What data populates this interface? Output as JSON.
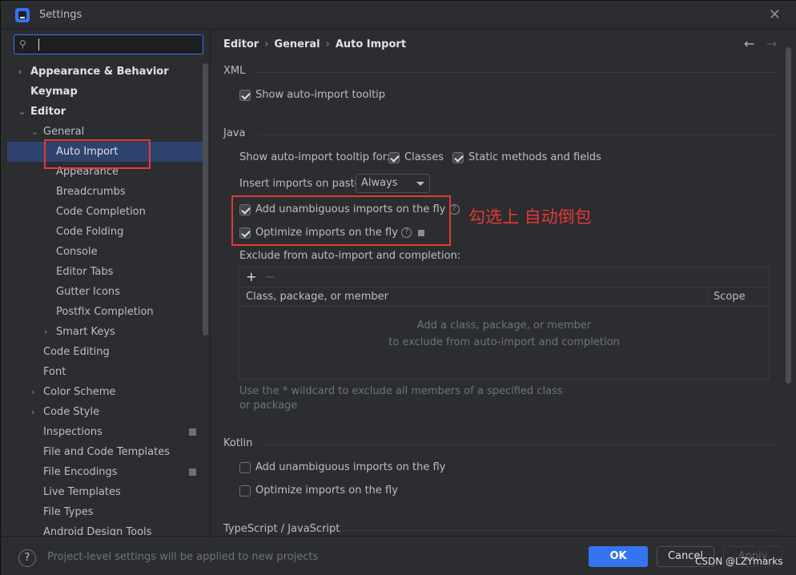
{
  "window": {
    "title": "Settings"
  },
  "search": {
    "value": ""
  },
  "sidebar": {
    "items": [
      {
        "label": "Appearance & Behavior",
        "chevron": "›"
      },
      {
        "label": "Keymap"
      },
      {
        "label": "Editor",
        "chevron": "⌄"
      },
      {
        "label": "General",
        "chevron": "⌄"
      },
      {
        "label": "Auto Import"
      },
      {
        "label": "Appearance"
      },
      {
        "label": "Breadcrumbs"
      },
      {
        "label": "Code Completion"
      },
      {
        "label": "Code Folding"
      },
      {
        "label": "Console"
      },
      {
        "label": "Editor Tabs"
      },
      {
        "label": "Gutter Icons"
      },
      {
        "label": "Postfix Completion"
      },
      {
        "label": "Smart Keys",
        "chevron": "›"
      },
      {
        "label": "Code Editing"
      },
      {
        "label": "Font"
      },
      {
        "label": "Color Scheme",
        "chevron": "›"
      },
      {
        "label": "Code Style",
        "chevron": "›"
      },
      {
        "label": "Inspections"
      },
      {
        "label": "File and Code Templates"
      },
      {
        "label": "File Encodings"
      },
      {
        "label": "Live Templates"
      },
      {
        "label": "File Types"
      },
      {
        "label": "Android Design Tools"
      }
    ]
  },
  "breadcrumb": {
    "part1": "Editor",
    "part2": "General",
    "part3": "Auto Import",
    "sep": "›"
  },
  "xml": {
    "title": "XML",
    "show_tooltip": {
      "label": "Show auto-import tooltip",
      "checked": true
    }
  },
  "java": {
    "title": "Java",
    "tooltip_for_label": "Show auto-import tooltip for:",
    "classes": {
      "label": "Classes",
      "checked": true
    },
    "static_methods": {
      "label": "Static methods and fields",
      "checked": true
    },
    "insert_imports_label": "Insert imports on paste:",
    "insert_imports_value": "Always",
    "add_unambiguous": {
      "label": "Add unambiguous imports on the fly",
      "checked": true
    },
    "optimize_imports": {
      "label": "Optimize imports on the fly",
      "checked": true
    },
    "exclude_label": "Exclude from auto-import and completion:",
    "table": {
      "col1": "Class, package, or member",
      "col2": "Scope",
      "empty_line1": "Add a class, package, or member",
      "empty_line2": "to exclude from auto-import and completion"
    },
    "hint": "Use the * wildcard to exclude all members of a specified class or package"
  },
  "kotlin": {
    "title": "Kotlin",
    "add_unambiguous": {
      "label": "Add unambiguous imports on the fly",
      "checked": false
    },
    "optimize_imports": {
      "label": "Optimize imports on the fly",
      "checked": false
    }
  },
  "ts": {
    "title": "TypeScript / JavaScript"
  },
  "annotation": "勾选上 自动倒包",
  "footer": {
    "help": "?",
    "text": "Project-level settings will be applied to new projects",
    "ok": "OK",
    "cancel": "Cancel",
    "apply": "Apply"
  },
  "watermark": "CSDN @LZYmarks",
  "colors": {
    "accent": "#3574f0",
    "annotation": "#e53935",
    "selection": "#2e436e"
  }
}
